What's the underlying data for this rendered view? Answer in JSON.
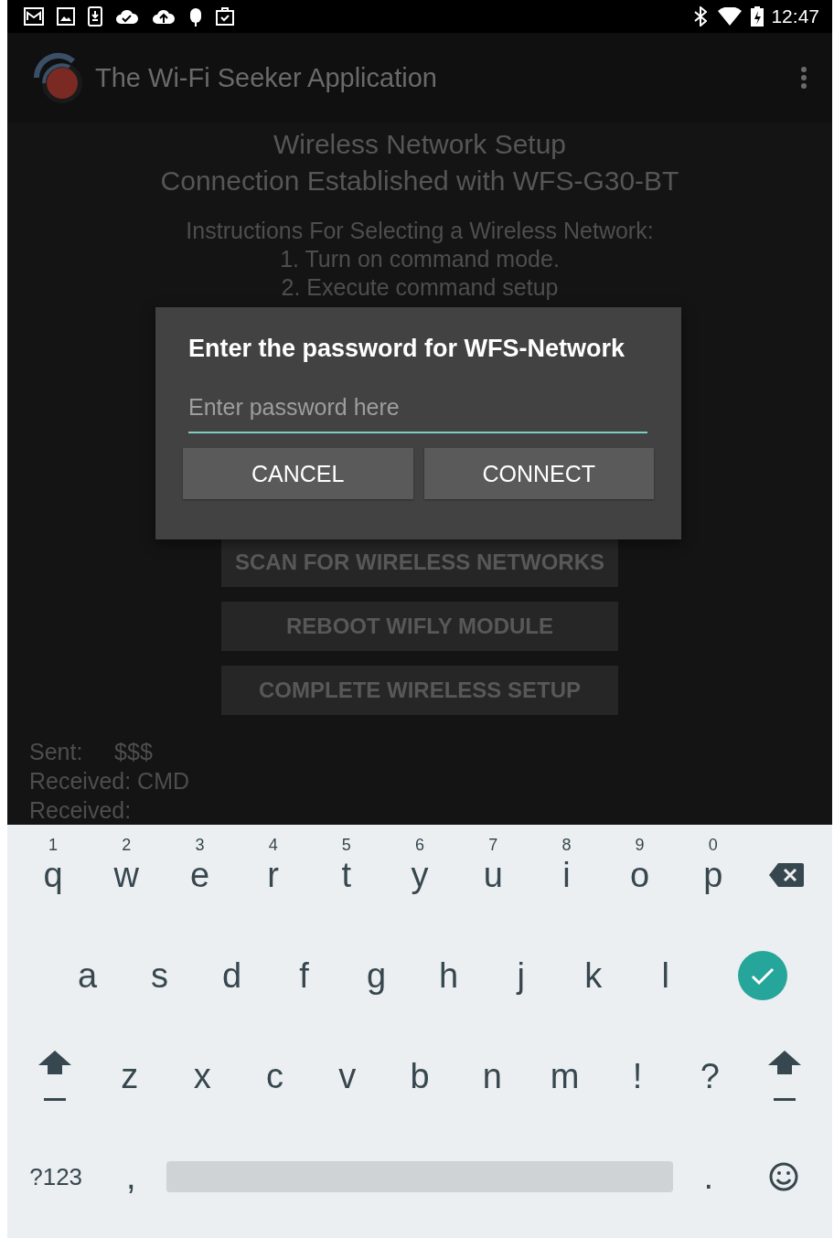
{
  "status_bar": {
    "time": "12:47"
  },
  "app_bar": {
    "title": "The Wi-Fi Seeker Application"
  },
  "content": {
    "heading": [
      "Wireless Network Setup",
      "Connection Established with WFS-G30-BT"
    ],
    "instructions": [
      "Instructions For Selecting a Wireless Network:",
      "1. Turn on command mode.",
      "2. Execute command setup"
    ],
    "buttons": [
      "SCAN FOR WIRELESS NETWORKS",
      "REBOOT WIFLY MODULE",
      "COMPLETE WIRELESS SETUP"
    ],
    "log": [
      {
        "label": "Sent:",
        "value": "$$$"
      },
      {
        "label": "Received:",
        "value": "CMD"
      },
      {
        "label": "Received:"
      }
    ]
  },
  "dialog": {
    "title": "Enter the password for WFS-Network",
    "placeholder": "Enter password here",
    "buttons": [
      "CANCEL",
      "CONNECT"
    ]
  },
  "keyboard": {
    "rows": [
      {
        "keys": [
          {
            "kind": "letter",
            "label": "q",
            "hint": "1"
          },
          {
            "kind": "letter",
            "label": "w",
            "hint": "2"
          },
          {
            "kind": "letter",
            "label": "e",
            "hint": "3"
          },
          {
            "kind": "letter",
            "label": "r",
            "hint": "4"
          },
          {
            "kind": "letter",
            "label": "t",
            "hint": "5"
          },
          {
            "kind": "letter",
            "label": "y",
            "hint": "6"
          },
          {
            "kind": "letter",
            "label": "u",
            "hint": "7"
          },
          {
            "kind": "letter",
            "label": "i",
            "hint": "8"
          },
          {
            "kind": "letter",
            "label": "o",
            "hint": "9"
          },
          {
            "kind": "letter",
            "label": "p",
            "hint": "0"
          },
          {
            "kind": "backspace"
          }
        ]
      },
      {
        "keys": [
          {
            "kind": "letter",
            "label": "a"
          },
          {
            "kind": "letter",
            "label": "s"
          },
          {
            "kind": "letter",
            "label": "d"
          },
          {
            "kind": "letter",
            "label": "f"
          },
          {
            "kind": "letter",
            "label": "g"
          },
          {
            "kind": "letter",
            "label": "h"
          },
          {
            "kind": "letter",
            "label": "j"
          },
          {
            "kind": "letter",
            "label": "k"
          },
          {
            "kind": "letter",
            "label": "l"
          },
          {
            "kind": "enter"
          }
        ]
      },
      {
        "keys": [
          {
            "kind": "shift"
          },
          {
            "kind": "letter",
            "label": "z"
          },
          {
            "kind": "letter",
            "label": "x"
          },
          {
            "kind": "letter",
            "label": "c"
          },
          {
            "kind": "letter",
            "label": "v"
          },
          {
            "kind": "letter",
            "label": "b"
          },
          {
            "kind": "letter",
            "label": "n"
          },
          {
            "kind": "letter",
            "label": "m"
          },
          {
            "kind": "letter",
            "label": "!"
          },
          {
            "kind": "letter",
            "label": "?"
          },
          {
            "kind": "shift"
          }
        ]
      },
      {
        "keys": [
          {
            "kind": "symbols",
            "label": "?123"
          },
          {
            "kind": "letter",
            "label": ","
          },
          {
            "kind": "space"
          },
          {
            "kind": "letter",
            "label": "."
          },
          {
            "kind": "emoji"
          }
        ]
      }
    ]
  }
}
